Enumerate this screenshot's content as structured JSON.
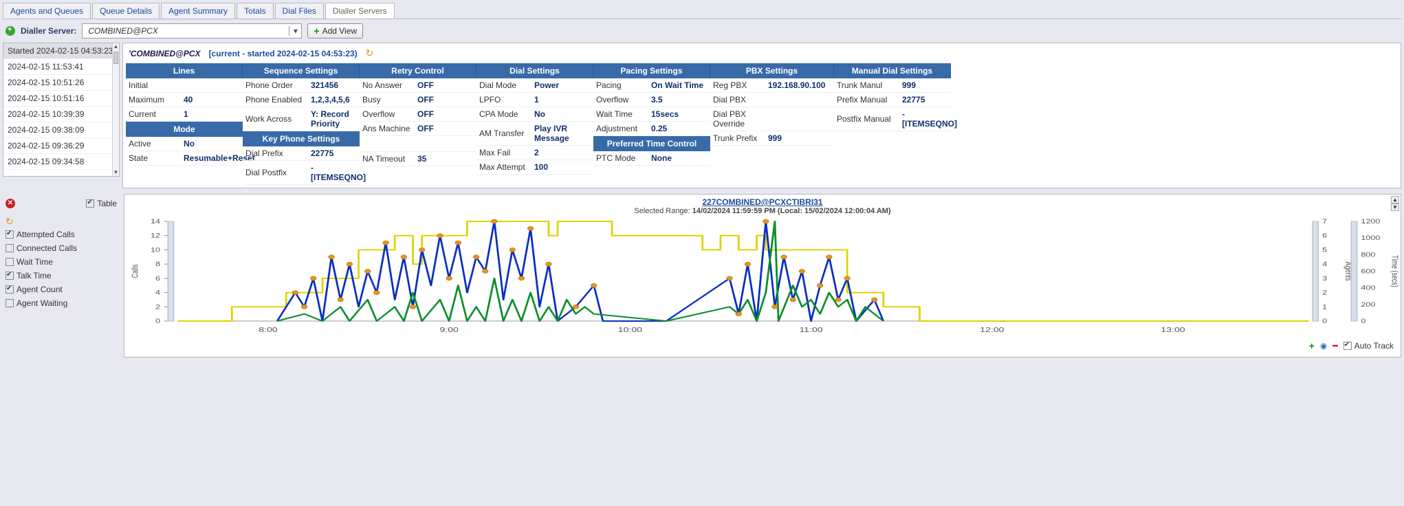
{
  "tabs": [
    "Agents and Queues",
    "Queue Details",
    "Agent Summary",
    "Totals",
    "Dial Files",
    "Dialler Servers"
  ],
  "active_tab_index": 5,
  "toolbar": {
    "label": "Dialler Server:",
    "server_value": "COMBINED@PCX",
    "add_view": "Add View"
  },
  "timestamps": {
    "items": [
      "Started 2024-02-15 04:53:23",
      "2024-02-15 11:53:41",
      "2024-02-15 10:51:26",
      "2024-02-15 10:51:16",
      "2024-02-15 10:39:39",
      "2024-02-15 09:38:09",
      "2024-02-15 09:36:29",
      "2024-02-15 09:34:58"
    ],
    "selected_index": 0
  },
  "details_header": {
    "name": "'COMBINED@PCX",
    "status": "[current - started 2024-02-15 04:53:23)"
  },
  "settings": {
    "headers": [
      "Lines",
      "Sequence Settings",
      "Retry Control",
      "Dial Settings",
      "Pacing Settings",
      "PBX Settings",
      "Manual Dial Settings"
    ],
    "sub_headers": {
      "mode": "Mode",
      "keyphone": "Key Phone Settings",
      "ptc": "Preferred Time Control"
    },
    "lines": {
      "initial_k": "Initial",
      "initial_v": "",
      "max_k": "Maximum",
      "max_v": "40",
      "cur_k": "Current",
      "cur_v": "1",
      "active_k": "Active",
      "active_v": "No",
      "state_k": "State",
      "state_v": "Resumable+Reset"
    },
    "seq": {
      "order_k": "Phone Order",
      "order_v": "321456",
      "enabled_k": "Phone Enabled",
      "enabled_v": "1,2,3,4,5,6",
      "work_k": "Work Across",
      "work_v": "Y: Record Priority",
      "prefix_k": "Dial Prefix",
      "prefix_v": "22775",
      "postfix_k": "Dial Postfix",
      "postfix_v": "-[ITEMSEQNO]"
    },
    "retry": {
      "na_k": "No Answer",
      "na_v": "OFF",
      "busy_k": "Busy",
      "busy_v": "OFF",
      "ovf_k": "Overflow",
      "ovf_v": "OFF",
      "ans_k": "Ans Machine",
      "ans_v": "OFF",
      "nat_k": "NA Timeout",
      "nat_v": "35"
    },
    "dial": {
      "mode_k": "Dial Mode",
      "mode_v": "Power",
      "lpfo_k": "LPFO",
      "lpfo_v": "1",
      "cpa_k": "CPA Mode",
      "cpa_v": "No",
      "amt_k": "AM Transfer",
      "amt_v": "Play IVR Message",
      "maxfail_k": "Max Fail",
      "maxfail_v": "2",
      "maxatt_k": "Max Attempt",
      "maxatt_v": "100"
    },
    "pacing": {
      "pac_k": "Pacing",
      "pac_v": "On Wait Time",
      "ovf_k": "Overflow",
      "ovf_v": "3.5",
      "wait_k": "Wait Time",
      "wait_v": "15secs",
      "adj_k": "Adjustment",
      "adj_v": "0.25",
      "ptc_k": "PTC Mode",
      "ptc_v": "None"
    },
    "pbx": {
      "reg_k": "Reg PBX",
      "reg_v": "192.168.90.100",
      "dial_k": "Dial PBX",
      "dial_v": "",
      "ovr_k": "Dial PBX Override",
      "ovr_v": "",
      "trunk_k": "Trunk Prefix",
      "trunk_v": "999"
    },
    "manual": {
      "trunk_k": "Trunk Manul",
      "trunk_v": "999",
      "prefix_k": "Prefix Manual",
      "prefix_v": "22775",
      "postfix_k": "Postfix Manual",
      "postfix_v": "-[ITEMSEQNO]"
    }
  },
  "chart_side": {
    "table_label": "Table",
    "series": [
      {
        "key": "attempted",
        "label": "Attempted Calls",
        "checked": true
      },
      {
        "key": "connected",
        "label": "Connected Calls",
        "checked": false
      },
      {
        "key": "wait",
        "label": "Wait Time",
        "checked": false
      },
      {
        "key": "talk",
        "label": "Talk Time",
        "checked": true
      },
      {
        "key": "agents",
        "label": "Agent Count",
        "checked": true
      },
      {
        "key": "waiting",
        "label": "Agent Waiting",
        "checked": false
      }
    ]
  },
  "chart": {
    "title": "227COMBINED@PCXCTIBRI31",
    "subtitle_prefix": "Selected Range: ",
    "subtitle_value": "14/02/2024 11:59:59 PM (Local: 15/02/2024 12:00:04 AM)",
    "footer": {
      "auto_track": "Auto Track"
    }
  },
  "chart_data": {
    "type": "line",
    "x_ticks": [
      "8:00",
      "9:00",
      "10:00",
      "11:00",
      "12:00",
      "13:00"
    ],
    "y_left": {
      "label": "Calls",
      "min": 0,
      "max": 14,
      "ticks": [
        0,
        2,
        4,
        6,
        8,
        10,
        12,
        14
      ]
    },
    "y_right1": {
      "label": "Agents",
      "min": 0,
      "max": 7,
      "ticks": [
        0,
        1,
        2,
        3,
        4,
        5,
        6,
        7
      ]
    },
    "y_right2": {
      "label": "Time (secs)",
      "min": 0,
      "max": 1200,
      "ticks": [
        0,
        200,
        400,
        600,
        800,
        1000,
        1200
      ]
    },
    "hour_range": [
      7.5,
      13.75
    ],
    "series": [
      {
        "name": "Agent Count",
        "axis": "right1",
        "color": "#e0d400",
        "style": "step",
        "points": [
          [
            7.5,
            0
          ],
          [
            7.8,
            0
          ],
          [
            7.8,
            1
          ],
          [
            8.1,
            1
          ],
          [
            8.1,
            2
          ],
          [
            8.3,
            2
          ],
          [
            8.3,
            3
          ],
          [
            8.5,
            3
          ],
          [
            8.5,
            5
          ],
          [
            8.7,
            5
          ],
          [
            8.7,
            6
          ],
          [
            8.8,
            6
          ],
          [
            8.8,
            4
          ],
          [
            8.85,
            4
          ],
          [
            8.85,
            6
          ],
          [
            9.1,
            6
          ],
          [
            9.1,
            7
          ],
          [
            9.55,
            7
          ],
          [
            9.55,
            6
          ],
          [
            9.6,
            6
          ],
          [
            9.6,
            7
          ],
          [
            9.9,
            7
          ],
          [
            9.9,
            6
          ],
          [
            10.4,
            6
          ],
          [
            10.4,
            5
          ],
          [
            10.5,
            5
          ],
          [
            10.5,
            6
          ],
          [
            10.6,
            6
          ],
          [
            10.6,
            5
          ],
          [
            10.7,
            5
          ],
          [
            10.7,
            6
          ],
          [
            10.75,
            6
          ],
          [
            10.75,
            5
          ],
          [
            11.2,
            5
          ],
          [
            11.2,
            2
          ],
          [
            11.4,
            2
          ],
          [
            11.4,
            1
          ],
          [
            11.6,
            1
          ],
          [
            11.6,
            0
          ],
          [
            13.75,
            0
          ]
        ]
      },
      {
        "name": "Attempted Calls",
        "axis": "left",
        "color": "#0b2fbf",
        "style": "spiky",
        "points": [
          [
            8.05,
            0
          ],
          [
            8.15,
            4
          ],
          [
            8.2,
            2
          ],
          [
            8.25,
            6
          ],
          [
            8.3,
            0
          ],
          [
            8.35,
            9
          ],
          [
            8.4,
            3
          ],
          [
            8.45,
            8
          ],
          [
            8.5,
            2
          ],
          [
            8.55,
            7
          ],
          [
            8.6,
            4
          ],
          [
            8.65,
            11
          ],
          [
            8.7,
            3
          ],
          [
            8.75,
            9
          ],
          [
            8.8,
            2
          ],
          [
            8.85,
            10
          ],
          [
            8.9,
            5
          ],
          [
            8.95,
            12
          ],
          [
            9.0,
            6
          ],
          [
            9.05,
            11
          ],
          [
            9.1,
            4
          ],
          [
            9.15,
            9
          ],
          [
            9.2,
            7
          ],
          [
            9.25,
            14
          ],
          [
            9.3,
            3
          ],
          [
            9.35,
            10
          ],
          [
            9.4,
            6
          ],
          [
            9.45,
            13
          ],
          [
            9.5,
            2
          ],
          [
            9.55,
            8
          ],
          [
            9.6,
            0
          ],
          [
            9.7,
            2
          ],
          [
            9.8,
            5
          ],
          [
            9.85,
            0
          ],
          [
            10.2,
            0
          ],
          [
            10.55,
            6
          ],
          [
            10.6,
            1
          ],
          [
            10.65,
            8
          ],
          [
            10.7,
            0
          ],
          [
            10.75,
            14
          ],
          [
            10.8,
            2
          ],
          [
            10.85,
            9
          ],
          [
            10.9,
            3
          ],
          [
            10.95,
            7
          ],
          [
            11.0,
            0
          ],
          [
            11.05,
            5
          ],
          [
            11.1,
            9
          ],
          [
            11.15,
            3
          ],
          [
            11.2,
            6
          ],
          [
            11.25,
            0
          ],
          [
            11.35,
            3
          ],
          [
            11.4,
            0
          ]
        ]
      },
      {
        "name": "Talk Time",
        "axis": "left",
        "color": "#0a8f2a",
        "style": "spiky",
        "points": [
          [
            8.05,
            0
          ],
          [
            8.2,
            1
          ],
          [
            8.3,
            0
          ],
          [
            8.4,
            2
          ],
          [
            8.45,
            0
          ],
          [
            8.55,
            3
          ],
          [
            8.6,
            0
          ],
          [
            8.7,
            2
          ],
          [
            8.75,
            0
          ],
          [
            8.8,
            4
          ],
          [
            8.85,
            0
          ],
          [
            8.95,
            3
          ],
          [
            9.0,
            0
          ],
          [
            9.05,
            5
          ],
          [
            9.1,
            0
          ],
          [
            9.15,
            2
          ],
          [
            9.2,
            0
          ],
          [
            9.25,
            6
          ],
          [
            9.3,
            0
          ],
          [
            9.35,
            3
          ],
          [
            9.4,
            0
          ],
          [
            9.45,
            4
          ],
          [
            9.5,
            0
          ],
          [
            9.55,
            2
          ],
          [
            9.6,
            0
          ],
          [
            9.65,
            3
          ],
          [
            9.7,
            1
          ],
          [
            9.75,
            2
          ],
          [
            9.8,
            1
          ],
          [
            10.2,
            0
          ],
          [
            10.55,
            2
          ],
          [
            10.6,
            1
          ],
          [
            10.65,
            3
          ],
          [
            10.7,
            0
          ],
          [
            10.75,
            4
          ],
          [
            10.8,
            14
          ],
          [
            10.82,
            0
          ],
          [
            10.9,
            5
          ],
          [
            10.95,
            2
          ],
          [
            11.0,
            3
          ],
          [
            11.05,
            1
          ],
          [
            11.1,
            4
          ],
          [
            11.15,
            2
          ],
          [
            11.2,
            3
          ],
          [
            11.25,
            0
          ],
          [
            11.3,
            2
          ],
          [
            11.35,
            1
          ],
          [
            11.4,
            0
          ]
        ]
      }
    ],
    "markers": {
      "series": "Attempted Calls",
      "color": "#e7941e",
      "points": [
        [
          8.15,
          4
        ],
        [
          8.25,
          6
        ],
        [
          8.35,
          9
        ],
        [
          8.45,
          8
        ],
        [
          8.55,
          7
        ],
        [
          8.65,
          11
        ],
        [
          8.75,
          9
        ],
        [
          8.85,
          10
        ],
        [
          8.95,
          12
        ],
        [
          9.05,
          11
        ],
        [
          9.15,
          9
        ],
        [
          9.25,
          14
        ],
        [
          9.35,
          10
        ],
        [
          9.45,
          13
        ],
        [
          9.55,
          8
        ],
        [
          9.8,
          5
        ],
        [
          10.55,
          6
        ],
        [
          10.65,
          8
        ],
        [
          10.75,
          14
        ],
        [
          10.85,
          9
        ],
        [
          10.95,
          7
        ],
        [
          11.05,
          5
        ],
        [
          11.1,
          9
        ],
        [
          11.2,
          6
        ],
        [
          11.35,
          3
        ],
        [
          8.2,
          2
        ],
        [
          8.4,
          3
        ],
        [
          8.6,
          4
        ],
        [
          8.8,
          2
        ],
        [
          9.0,
          6
        ],
        [
          9.2,
          7
        ],
        [
          9.4,
          6
        ],
        [
          9.7,
          2
        ],
        [
          10.6,
          1
        ],
        [
          10.8,
          2
        ],
        [
          10.9,
          3
        ],
        [
          11.15,
          3
        ]
      ]
    }
  }
}
